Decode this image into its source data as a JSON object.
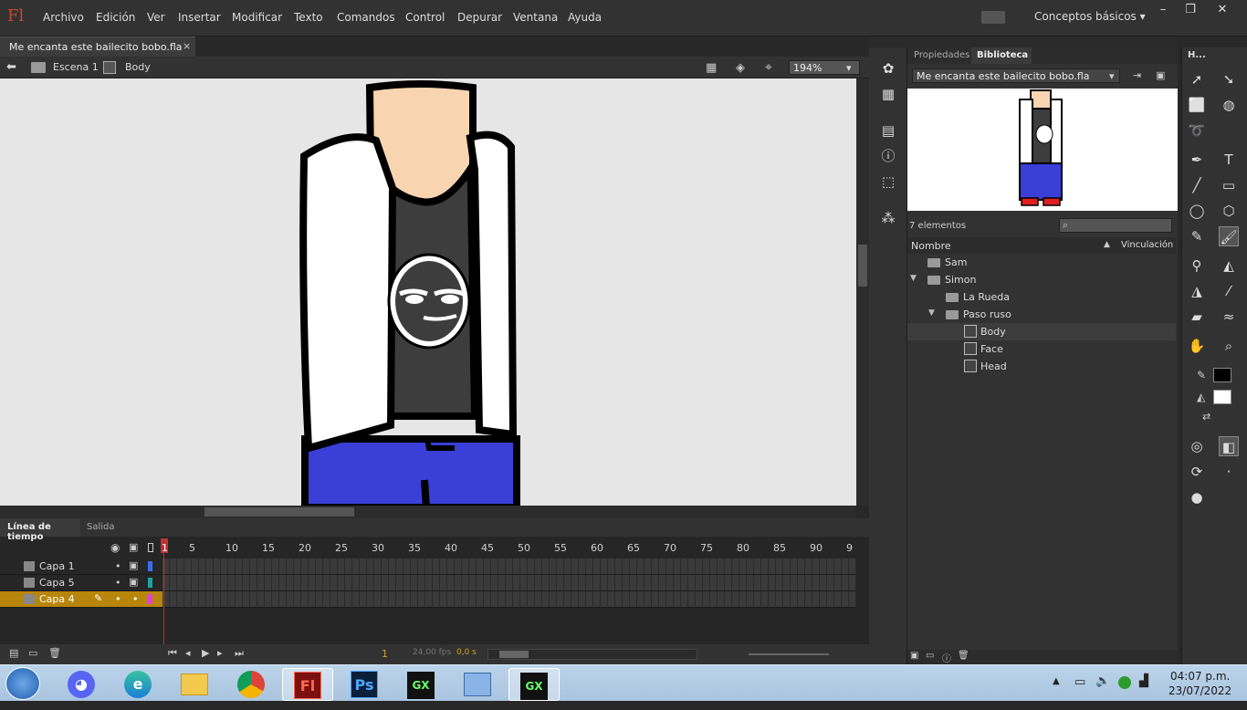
{
  "app": {
    "logo": "Fl",
    "workspace": "Conceptos básicos"
  },
  "menu": [
    "Archivo",
    "Edición",
    "Ver",
    "Insertar",
    "Modificar",
    "Texto",
    "Comandos",
    "Control",
    "Depurar",
    "Ventana",
    "Ayuda"
  ],
  "window_buttons": [
    "–",
    "❐",
    "✕"
  ],
  "document": {
    "tab_title": "Me encanta este bailecito bobo.fla",
    "close": "×"
  },
  "editbar": {
    "scene": "Escena 1",
    "symbol": "Body",
    "zoom": "194%"
  },
  "timeline": {
    "tabs": [
      "Línea de tiempo",
      "Salida"
    ],
    "ruler": [
      "1",
      "5",
      "10",
      "15",
      "20",
      "25",
      "30",
      "35",
      "40",
      "45",
      "50",
      "55",
      "60",
      "65",
      "70",
      "75",
      "80",
      "85",
      "90",
      "9"
    ],
    "layers": [
      {
        "name": "Capa 1",
        "color": "#3a6cf0",
        "selected": false
      },
      {
        "name": "Capa 5",
        "color": "#19a4a4",
        "selected": false
      },
      {
        "name": "Capa 4",
        "color": "#e040d8",
        "selected": true
      }
    ],
    "status": {
      "frame": "1",
      "fps": "24,00 fps",
      "time": "0,0 s"
    }
  },
  "library": {
    "tabs": [
      "Propiedades",
      "Biblioteca"
    ],
    "file": "Me encanta este bailecito bobo.fla",
    "count": "7 elementos",
    "columns": [
      "Nombre",
      "Vinculación"
    ],
    "items": [
      {
        "name": "Sam",
        "type": "folder"
      },
      {
        "name": "Simon",
        "type": "folder-open"
      },
      {
        "name": "La Rueda",
        "type": "folder"
      },
      {
        "name": "Paso ruso",
        "type": "folder-open"
      },
      {
        "name": "Body",
        "type": "symbol"
      },
      {
        "name": "Face",
        "type": "symbol"
      },
      {
        "name": "Head",
        "type": "symbol"
      }
    ]
  },
  "tools_title": "H...",
  "taskbar": {
    "time": "04:07 p.m.",
    "date": "23/07/2022",
    "apps": [
      "Discord",
      "Edge",
      "Explorador",
      "Chrome",
      "Fl",
      "Ps",
      "GX",
      "Admin",
      "GX"
    ]
  },
  "colors": {
    "accent": "#c8452e",
    "selected_layer": "#b8860b",
    "jeans": "#3a3fd8",
    "skin": "#f8d5b0"
  }
}
